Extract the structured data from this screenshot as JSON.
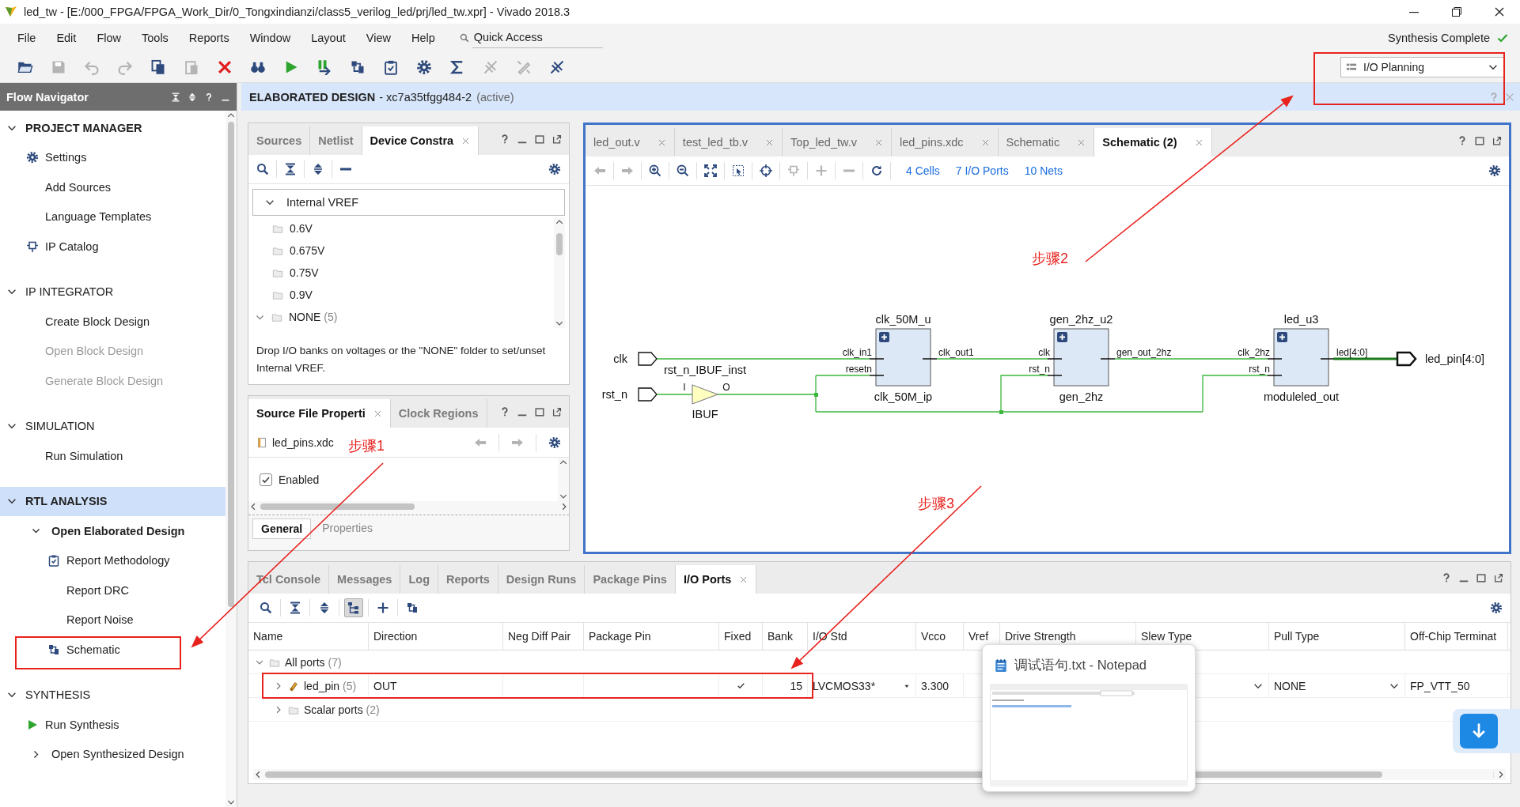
{
  "window": {
    "title": "led_tw - [E:/000_FPGA/FPGA_Work_Dir/0_Tongxindianzi/class5_verilog_led/prj/led_tw.xpr] - Vivado 2018.3"
  },
  "menu": [
    "File",
    "Edit",
    "Flow",
    "Tools",
    "Reports",
    "Window",
    "Layout",
    "View",
    "Help"
  ],
  "quick_access": {
    "placeholder": "Quick Access"
  },
  "status": {
    "text": "Synthesis Complete",
    "done": true
  },
  "toolbar": [
    {
      "kind": "open",
      "disabled": false
    },
    {
      "kind": "save",
      "disabled": true
    },
    {
      "kind": "undo",
      "disabled": true
    },
    {
      "kind": "redo",
      "disabled": true
    },
    {
      "kind": "copy",
      "disabled": false
    },
    {
      "kind": "paste",
      "disabled": true
    },
    {
      "kind": "delete",
      "disabled": false
    },
    {
      "kind": "find",
      "disabled": false
    },
    {
      "kind": "run",
      "disabled": false
    },
    {
      "kind": "step",
      "disabled": false
    },
    {
      "kind": "schematic",
      "disabled": false
    },
    {
      "kind": "report",
      "disabled": false
    },
    {
      "kind": "settings",
      "disabled": false
    },
    {
      "kind": "sum",
      "disabled": false
    },
    {
      "kind": "debug",
      "disabled": true
    },
    {
      "kind": "mark",
      "disabled": true
    },
    {
      "kind": "unmark",
      "disabled": false
    }
  ],
  "layout_selector": {
    "value": "I/O Planning"
  },
  "flow_navigator": {
    "title": "Flow Navigator",
    "sections": [
      {
        "title": "PROJECT MANAGER",
        "active": true,
        "selected": false,
        "expanded": true,
        "items": [
          {
            "label": "Settings",
            "kind": "settings",
            "disabled": false
          },
          {
            "label": "Add Sources",
            "kind": "action",
            "disabled": false
          },
          {
            "label": "Language Templates",
            "kind": "action",
            "disabled": false
          },
          {
            "label": "IP Catalog",
            "kind": "ip",
            "disabled": false
          }
        ]
      },
      {
        "title": "IP INTEGRATOR",
        "active": false,
        "selected": false,
        "expanded": true,
        "items": [
          {
            "label": "Create Block Design",
            "kind": "action",
            "disabled": false
          },
          {
            "label": "Open Block Design",
            "kind": "action",
            "disabled": true
          },
          {
            "label": "Generate Block Design",
            "kind": "action",
            "disabled": true
          }
        ]
      },
      {
        "title": "SIMULATION",
        "active": false,
        "selected": false,
        "expanded": true,
        "items": [
          {
            "label": "Run Simulation",
            "kind": "action",
            "disabled": false
          }
        ]
      },
      {
        "title": "RTL ANALYSIS",
        "active": true,
        "selected": true,
        "expanded": true,
        "items": [
          {
            "label": "Open Elaborated Design",
            "kind": "group",
            "expanded": true,
            "disabled": false,
            "children": [
              {
                "label": "Report Methodology",
                "kind": "report",
                "disabled": false
              },
              {
                "label": "Report DRC",
                "kind": "action",
                "disabled": false
              },
              {
                "label": "Report Noise",
                "kind": "action",
                "disabled": false
              },
              {
                "label": "Schematic",
                "kind": "schematic",
                "disabled": false
              }
            ]
          }
        ]
      },
      {
        "title": "SYNTHESIS",
        "active": false,
        "selected": false,
        "expanded": true,
        "items": [
          {
            "label": "Run Synthesis",
            "kind": "run",
            "disabled": false
          },
          {
            "label": "Open Synthesized Design",
            "kind": "group",
            "expanded": false,
            "disabled": false
          }
        ]
      }
    ]
  },
  "design_header": {
    "title": "ELABORATED DESIGN",
    "part": "- xc7a35tfgg484-2",
    "state": "(active)"
  },
  "device_constraints": {
    "tabs": [
      {
        "label": "Sources",
        "selected": false,
        "closable": false
      },
      {
        "label": "Netlist",
        "selected": false,
        "closable": false
      },
      {
        "label": "Device Constra",
        "selected": true,
        "closable": true
      }
    ],
    "tree": {
      "label": "Internal VREF",
      "expanded": true,
      "children": [
        {
          "label": "0.6V",
          "kind": "folder"
        },
        {
          "label": "0.675V",
          "kind": "folder"
        },
        {
          "label": "0.75V",
          "kind": "folder"
        },
        {
          "label": "0.9V",
          "kind": "folder"
        },
        {
          "label": "NONE",
          "count": "(5)",
          "kind": "group",
          "expanded": true
        }
      ]
    },
    "hint": "Drop I/O banks on voltages or the \"NONE\" folder to set/unset Internal VREF."
  },
  "source_properties": {
    "tabs": [
      {
        "label": "Source File Properti",
        "selected": true,
        "closable": true
      },
      {
        "label": "Clock Regions",
        "selected": false,
        "closable": false
      }
    ],
    "file": "led_pins.xdc",
    "enabled": {
      "label": "Enabled",
      "checked": true
    },
    "subtabs": [
      {
        "label": "General",
        "selected": true
      },
      {
        "label": "Properties",
        "selected": false
      }
    ]
  },
  "editor": {
    "tabs": [
      {
        "label": "led_out.v",
        "selected": false
      },
      {
        "label": "test_led_tb.v",
        "selected": false
      },
      {
        "label": "Top_led_tw.v",
        "selected": false
      },
      {
        "label": "led_pins.xdc",
        "selected": false
      },
      {
        "label": "Schematic",
        "selected": false
      },
      {
        "label": "Schematic (2)",
        "selected": true
      }
    ],
    "tools": [
      {
        "kind": "back",
        "disabled": true
      },
      {
        "kind": "forward",
        "disabled": true
      },
      {
        "kind": "zoom_in",
        "disabled": false
      },
      {
        "kind": "zoom_out",
        "disabled": false
      },
      {
        "kind": "fit",
        "disabled": false
      },
      {
        "kind": "select",
        "disabled": false
      },
      {
        "kind": "target",
        "disabled": false
      },
      {
        "kind": "chip",
        "disabled": true
      },
      {
        "kind": "add",
        "disabled": true
      },
      {
        "kind": "remove",
        "disabled": true
      },
      {
        "kind": "refresh",
        "disabled": false
      }
    ],
    "counts": [
      "4 Cells",
      "7 I/O Ports",
      "10 Nets"
    ],
    "schematic": {
      "input_ports": [
        "clk",
        "rst_n"
      ],
      "output_port": "led_pin[4:0]",
      "buffer": {
        "instance": "rst_n_IBUF_inst",
        "type": "IBUF",
        "input_pin": "I",
        "output_pin": "O"
      },
      "cells": [
        {
          "instance": "clk_50M_u",
          "module": "clk_50M_ip",
          "inputs": [
            "clk_in1",
            "resetn"
          ],
          "output": "clk_out1"
        },
        {
          "instance": "gen_2hz_u2",
          "module": "gen_2hz",
          "inputs": [
            "clk",
            "rst_n"
          ],
          "output": "gen_out_2hz"
        },
        {
          "instance": "led_u3",
          "module": "moduleled_out",
          "inputs": [
            "clk_2hz",
            "rst_n"
          ],
          "output": "led[4:0]"
        }
      ]
    }
  },
  "console": {
    "tabs": [
      {
        "label": "Tcl Console",
        "selected": false,
        "closable": false
      },
      {
        "label": "Messages",
        "selected": false,
        "closable": false
      },
      {
        "label": "Log",
        "selected": false,
        "closable": false
      },
      {
        "label": "Reports",
        "selected": false,
        "closable": false
      },
      {
        "label": "Design Runs",
        "selected": false,
        "closable": false
      },
      {
        "label": "Package Pins",
        "selected": false,
        "closable": false
      },
      {
        "label": "I/O Ports",
        "selected": true,
        "closable": true
      }
    ],
    "tools": [
      {
        "kind": "search",
        "selected": false
      },
      {
        "kind": "collapse",
        "selected": false
      },
      {
        "kind": "expand",
        "selected": false
      },
      {
        "kind": "group",
        "selected": true
      },
      {
        "kind": "add",
        "selected": false
      },
      {
        "kind": "schematic",
        "selected": false
      }
    ],
    "columns": [
      "Name",
      "Direction",
      "Neg Diff Pair",
      "Package Pin",
      "Fixed",
      "Bank",
      "I/O Std",
      "Vcco",
      "Vref",
      "Drive Strength",
      "Slew Type",
      "Pull Type",
      "Off-Chip Terminat"
    ],
    "rows": [
      {
        "kind": "group",
        "name": "All ports",
        "count": "(7)",
        "expanded": true,
        "children": [
          {
            "kind": "bus",
            "name": "led_pin",
            "count": "(5)",
            "expanded": false,
            "direction": "OUT",
            "fixed": true,
            "bank": "15",
            "io_std": "LVCMOS33*",
            "vcco": "3.300",
            "pull_type": "NONE",
            "off_chip_termination": "FP_VTT_50"
          },
          {
            "kind": "group",
            "name": "Scalar ports",
            "count": "(2)",
            "expanded": false
          }
        ]
      }
    ]
  },
  "notepad_preview": {
    "title": "调试语句.txt - Notepad"
  },
  "annotations": {
    "steps": [
      "步骤1",
      "步骤2",
      "步骤3"
    ]
  }
}
